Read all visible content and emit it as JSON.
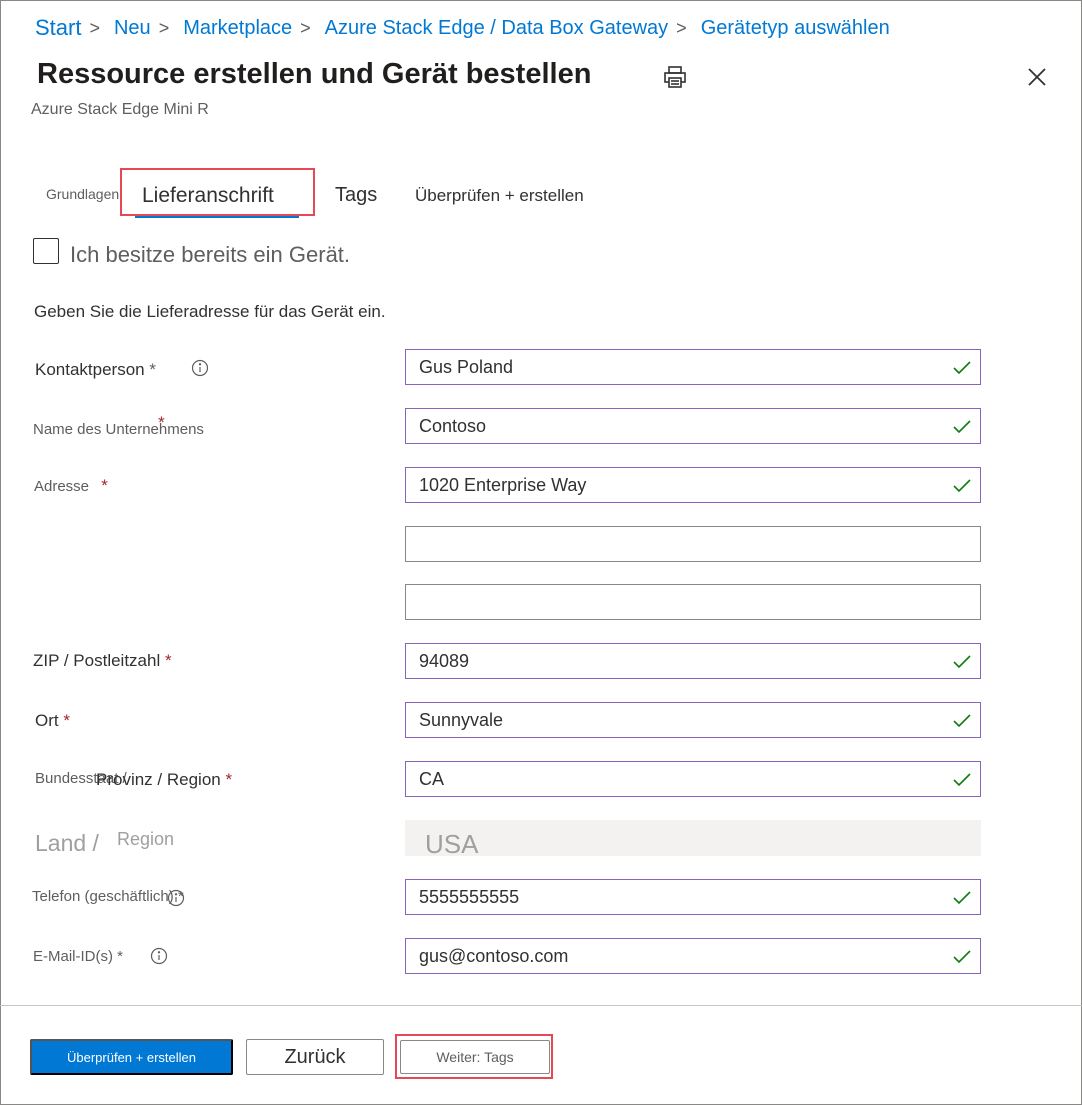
{
  "breadcrumb": [
    {
      "label": "Start"
    },
    {
      "label": "Neu"
    },
    {
      "label": "Marketplace"
    },
    {
      "label": "Azure Stack Edge / Data Box Gateway"
    },
    {
      "label": "Gerätetyp auswählen"
    }
  ],
  "header": {
    "title": "Ressource erstellen und Gerät bestellen",
    "subtitle": "Azure Stack Edge Mini R"
  },
  "tabs": [
    {
      "label": "Grundlagen"
    },
    {
      "label": "Lieferanschrift"
    },
    {
      "label": "Tags"
    },
    {
      "label": "Überprüfen + erstellen"
    }
  ],
  "checkbox": {
    "label": "Ich besitze bereits ein Gerät.",
    "checked": false
  },
  "instruction": "Geben Sie die Lieferadresse für das Gerät ein.",
  "form": {
    "contact": {
      "label": "Kontaktperson",
      "required": "*",
      "value": "Gus Poland"
    },
    "company": {
      "label": "Name des Unternehmens",
      "required": "*",
      "value": "Contoso"
    },
    "address": {
      "label": "Adresse",
      "required": "*",
      "value": "1020 Enterprise Way",
      "line2": "",
      "line3": ""
    },
    "zip": {
      "label": "ZIP / Postleitzahl",
      "required": "*",
      "value": "94089"
    },
    "city": {
      "label": "Ort",
      "required": "*",
      "value": "Sunnyvale"
    },
    "state": {
      "label_prefix": "Bundesstaat /",
      "label": "Provinz /  Region",
      "required": "*",
      "value": "CA"
    },
    "country": {
      "label": "Land /",
      "label2": "Region",
      "value": "USA"
    },
    "phone": {
      "label": "Telefon (geschäftlich)",
      "required": "*",
      "value": "5555555555"
    },
    "email": {
      "label": "E-Mail-ID(s)",
      "required": "*",
      "value": "gus@contoso.com"
    }
  },
  "footer": {
    "review_label": "Überprüfen + erstellen",
    "back_label": "Zurück",
    "next_label": "Weiter: Tags"
  },
  "colors": {
    "accent": "#0078d4",
    "highlight": "#e74856",
    "valid": "#107c10",
    "required": "#a4262c"
  }
}
